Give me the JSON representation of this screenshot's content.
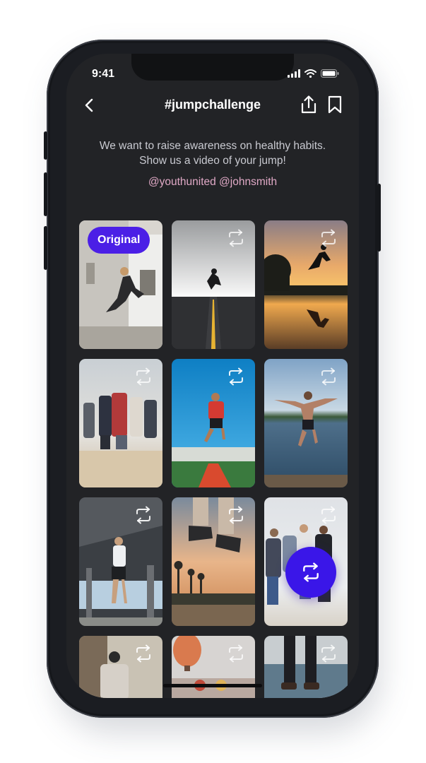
{
  "status_bar": {
    "time": "9:41"
  },
  "header": {
    "title": "#jumpchallenge"
  },
  "challenge": {
    "description_line1": "We want to raise awareness on healthy habits.",
    "description_line2": "Show us a video of your jump!",
    "mentions": "@youthunited @johnsmith"
  },
  "grid": {
    "original_badge": "Original"
  },
  "colors": {
    "accent": "#3a16e8",
    "background": "#222326",
    "mention": "#e0a9c6"
  },
  "icons": [
    "back-arrow-icon",
    "share-icon",
    "bookmark-icon",
    "repost-icon",
    "signal-icon",
    "wifi-icon",
    "battery-icon"
  ]
}
